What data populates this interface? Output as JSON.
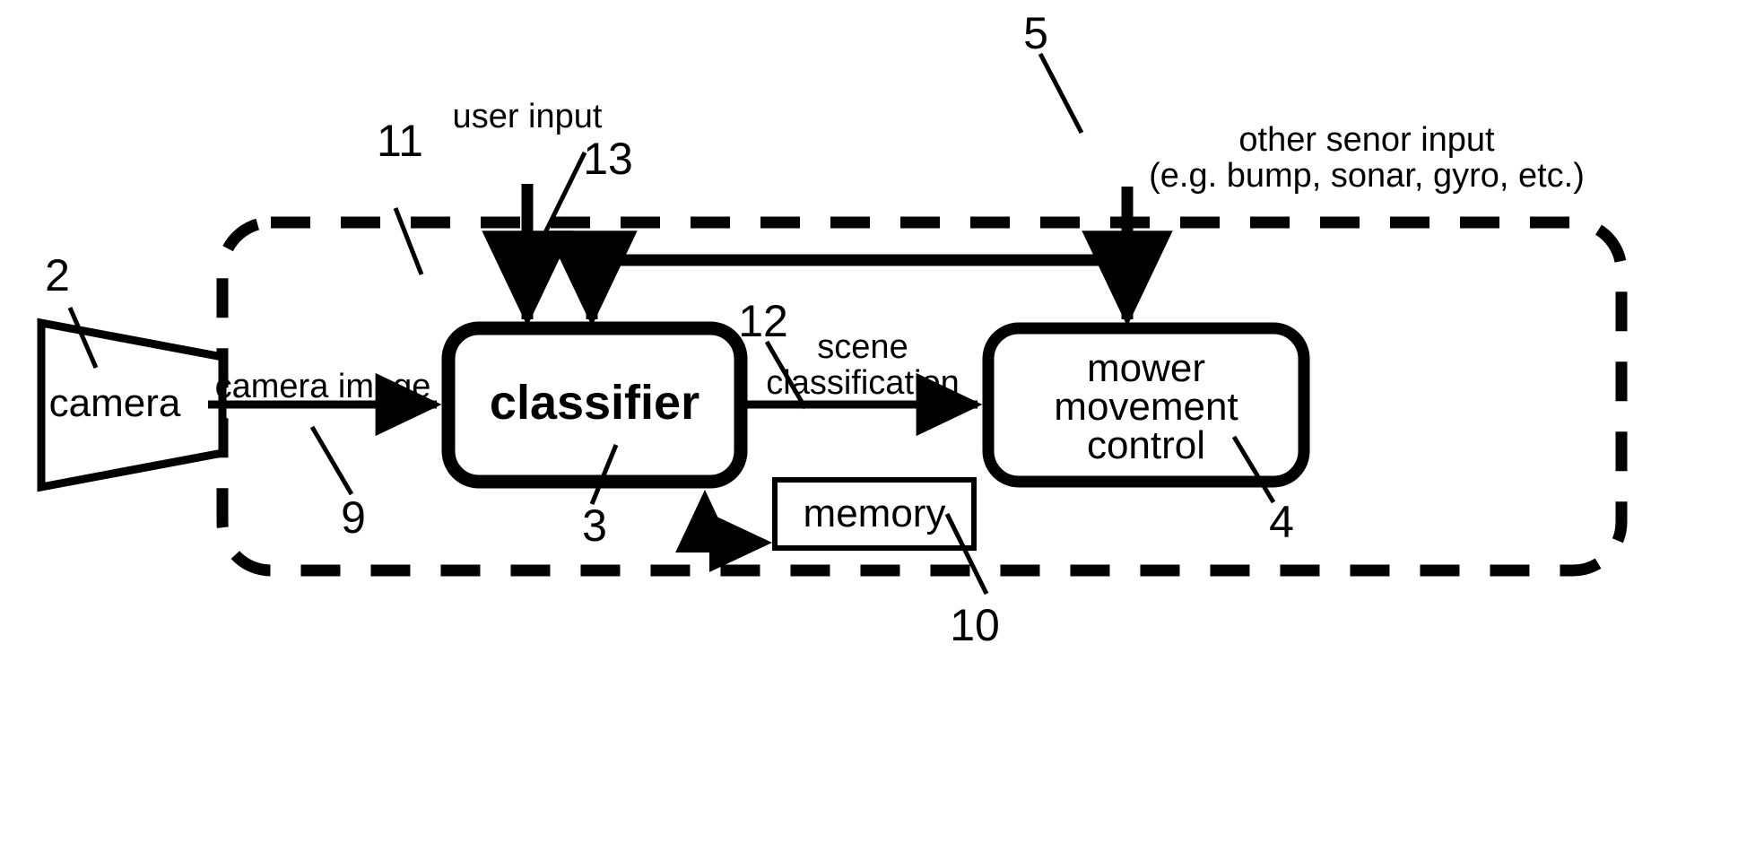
{
  "diagram": {
    "type": "patent-block-diagram",
    "background_color": "#ffffff",
    "stroke_color": "#000000",
    "boundary": {
      "name": "enclosure",
      "style": "dashed rounded rectangle",
      "ref": "11"
    },
    "blocks": [
      {
        "id": "camera",
        "label": "camera",
        "shape": "trapezoid",
        "ref": "2",
        "border": "thin"
      },
      {
        "id": "classifier",
        "label": "classifier",
        "shape": "rounded-rect",
        "ref": "3",
        "border": "bold"
      },
      {
        "id": "mower",
        "label": "mower\nmovement\ncontrol",
        "shape": "rounded-rect",
        "ref": "4",
        "border": "bold"
      },
      {
        "id": "memory",
        "label": "memory",
        "shape": "rect",
        "ref": "10",
        "border": "thin"
      }
    ],
    "flow_labels": [
      {
        "id": "camera-image",
        "text": "camera image",
        "ref": "9"
      },
      {
        "id": "scene-classification",
        "text": "scene\nclassification",
        "ref": "12"
      },
      {
        "id": "user-input",
        "text": "user input",
        "ref": "13"
      },
      {
        "id": "other-sensor-input",
        "text": "other senor input\n(e.g. bump, sonar, gyro, etc.)",
        "ref": "5"
      }
    ],
    "labels": {
      "camera": "camera",
      "classifier": "classifier",
      "mower_line1": "mower",
      "mower_line2": "movement",
      "mower_line3": "control",
      "memory": "memory",
      "camera_image": "camera image",
      "scene_line1": "scene",
      "scene_line2": "classification",
      "user_input": "user input",
      "sensor_line1": "other senor input",
      "sensor_line2": "(e.g. bump, sonar, gyro, etc.)"
    },
    "refs": {
      "camera": "2",
      "classifier": "3",
      "mower": "4",
      "sensor": "5",
      "camera_image": "9",
      "memory": "10",
      "enclosure": "11",
      "scene_classification": "12",
      "user_input": "13"
    }
  }
}
